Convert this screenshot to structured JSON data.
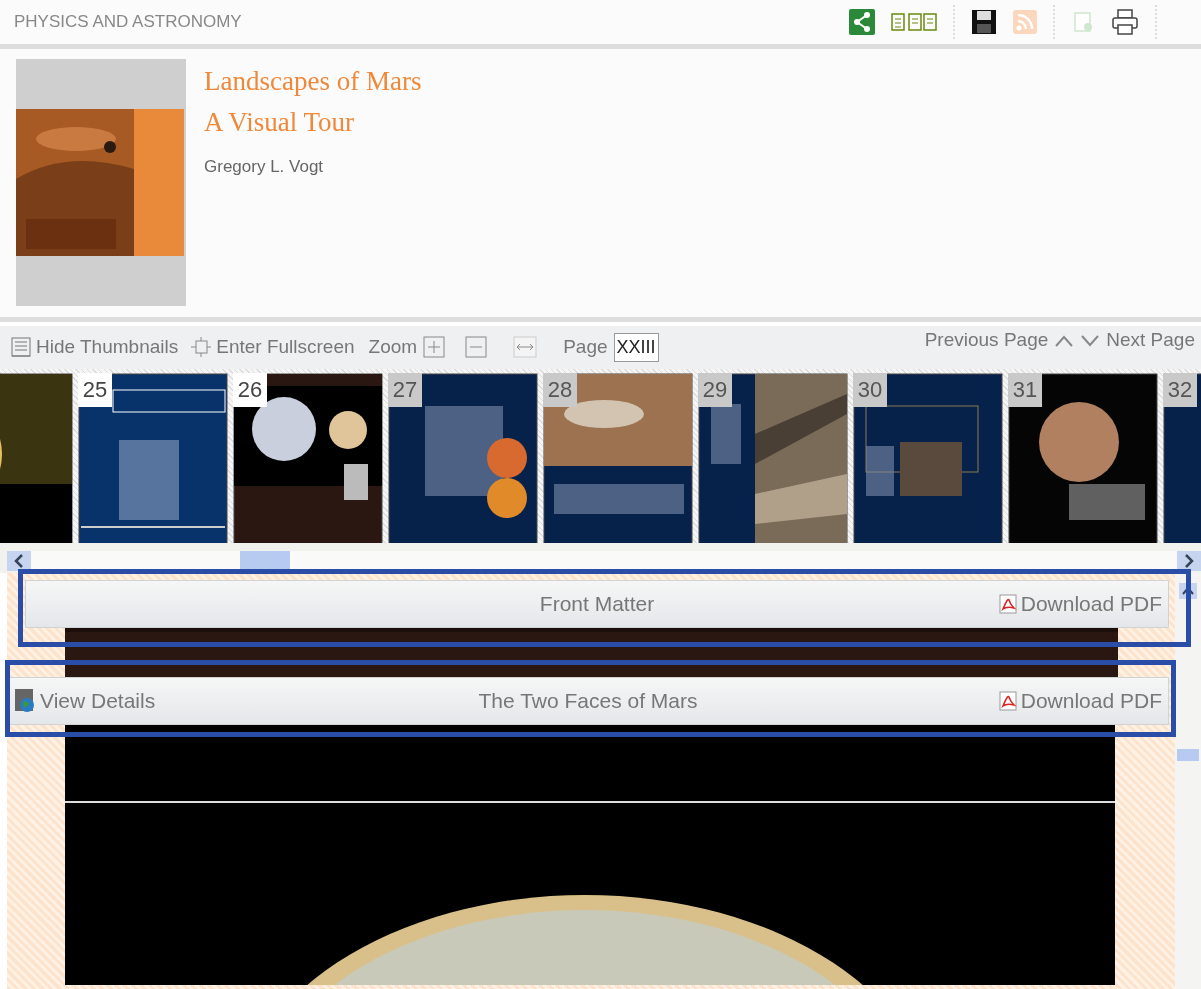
{
  "header": {
    "category": "PHYSICS AND ASTRONOMY"
  },
  "book": {
    "title_lines": [
      "Landscapes of Mars",
      "A Visual Tour"
    ],
    "author": "Gregory L. Vogt",
    "cover": {
      "kind": "picture"
    }
  },
  "toolbar": {
    "hide_thumbnails": "Hide Thumbnails",
    "enter_fullscreen": "Enter Fullscreen",
    "zoom": "Zoom",
    "page_label": "Page",
    "page_value": "XXIII",
    "previous": "Previous Page",
    "next": "Next Page"
  },
  "thumbnails": [
    {
      "kind": "picture"
    },
    {
      "kind": "picture",
      "number": "25",
      "highlighted": true
    },
    {
      "kind": "picture",
      "number": "26",
      "highlighted": true
    },
    {
      "kind": "picture",
      "number": "27",
      "highlighted": false
    },
    {
      "kind": "picture",
      "number": "28",
      "highlighted": false
    },
    {
      "kind": "picture",
      "number": "29",
      "highlighted": false
    },
    {
      "kind": "picture",
      "number": "30",
      "highlighted": false
    },
    {
      "kind": "picture",
      "number": "31",
      "highlighted": false
    },
    {
      "kind": "picture",
      "number": "32",
      "highlighted": false
    }
  ],
  "sections": [
    {
      "title": "Front Matter",
      "download": "Download PDF"
    },
    {
      "view_details": "View Details",
      "title": "The Two Faces of Mars",
      "download": "Download PDF"
    }
  ]
}
